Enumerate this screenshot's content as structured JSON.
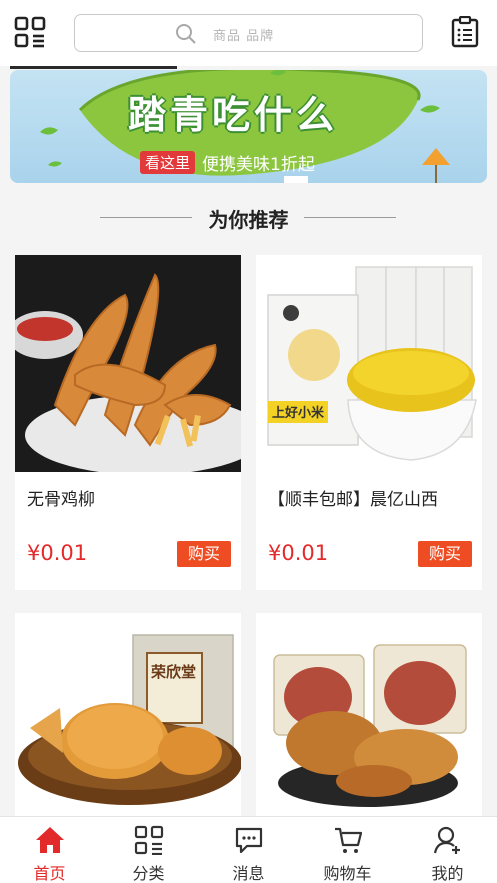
{
  "header": {
    "search_placeholder": "商品  品牌",
    "menu_icon": "grid-icon",
    "search_icon": "search-icon",
    "list_icon": "clipboard-list-icon"
  },
  "banner": {
    "title": "踏青吃什么",
    "tag": "看这里",
    "subtitle": "便携美味1折起"
  },
  "section": {
    "title": "为你推荐"
  },
  "products": [
    {
      "name": "无骨鸡柳",
      "price": "¥0.01",
      "buy_label": "购买"
    },
    {
      "name": "【顺丰包邮】晨亿山西",
      "price": "¥0.01",
      "buy_label": "购买",
      "image_text": "上好小米"
    },
    {
      "name": "",
      "price": "",
      "buy_label": "",
      "image_text": "荣欣堂"
    },
    {
      "name": "",
      "price": "",
      "buy_label": ""
    }
  ],
  "nav": [
    {
      "label": "首页",
      "icon": "home-icon",
      "active": true
    },
    {
      "label": "分类",
      "icon": "category-grid-icon",
      "active": false
    },
    {
      "label": "消息",
      "icon": "message-icon",
      "active": false
    },
    {
      "label": "购物车",
      "icon": "cart-icon",
      "active": false
    },
    {
      "label": "我的",
      "icon": "user-add-icon",
      "active": false
    }
  ],
  "colors": {
    "accent": "#e4292a",
    "buy_button": "#ee4c22",
    "background": "#f4f4f4"
  }
}
